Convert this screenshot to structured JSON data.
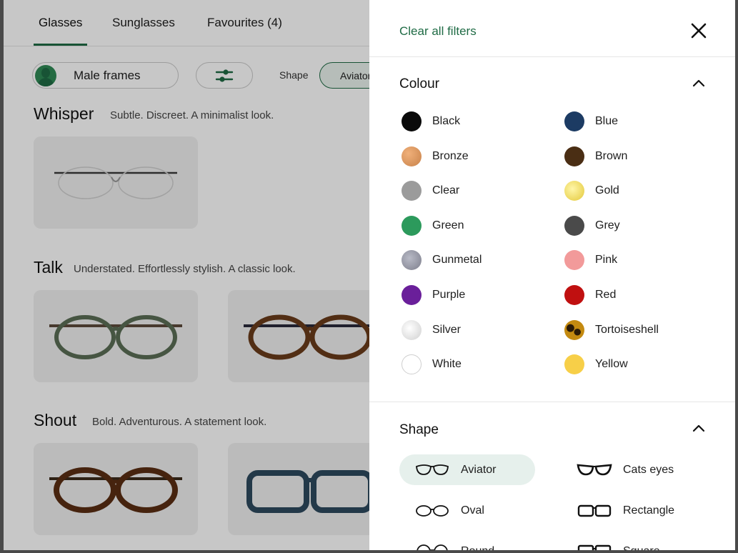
{
  "tabs": [
    {
      "label": "Glasses"
    },
    {
      "label": "Sunglasses"
    },
    {
      "label": "Favourites (4)"
    }
  ],
  "filterbar": {
    "gender_label": "Male frames",
    "shape_label": "Shape",
    "shape_chip": "Aviator"
  },
  "sections": [
    {
      "title": "Whisper",
      "subtitle": "Subtle. Discreet. A minimalist look."
    },
    {
      "title": "Talk",
      "subtitle": "Understated. Effortlessly stylish. A classic look."
    },
    {
      "title": "Shout",
      "subtitle": "Bold. Adventurous. A statement look."
    }
  ],
  "drawer": {
    "clear_all": "Clear all filters",
    "colour_title": "Colour",
    "shape_title": "Shape",
    "colours": [
      {
        "label": "Black",
        "color": "#0a0a0a"
      },
      {
        "label": "Blue",
        "color": "#1c3b63"
      },
      {
        "label": "Bronze",
        "color": "#c8824a"
      },
      {
        "label": "Brown",
        "color": "#4a2e14"
      },
      {
        "label": "Clear",
        "color": "#9b9b9b"
      },
      {
        "label": "Gold",
        "color": "#e3c83a"
      },
      {
        "label": "Green",
        "color": "#2c9a5c"
      },
      {
        "label": "Grey",
        "color": "#4a4a4a"
      },
      {
        "label": "Gunmetal",
        "color": "#7d7e8c"
      },
      {
        "label": "Pink",
        "color": "#f29a9a"
      },
      {
        "label": "Purple",
        "color": "#6a1f9a"
      },
      {
        "label": "Red",
        "color": "#c01010"
      },
      {
        "label": "Silver",
        "color": "#cfcfcf"
      },
      {
        "label": "Tortoiseshell",
        "color": "#c48a10"
      },
      {
        "label": "White",
        "color": "#ffffff"
      },
      {
        "label": "Yellow",
        "color": "#f7cf48"
      }
    ],
    "shapes": [
      {
        "label": "Aviator",
        "icon": "aviator-frame-icon",
        "selected": true
      },
      {
        "label": "Cats eyes",
        "icon": "cats-eyes-frame-icon",
        "selected": false
      },
      {
        "label": "Oval",
        "icon": "oval-frame-icon",
        "selected": false
      },
      {
        "label": "Rectangle",
        "icon": "rectangle-frame-icon",
        "selected": false
      },
      {
        "label": "Round",
        "icon": "round-frame-icon",
        "selected": false
      },
      {
        "label": "Square",
        "icon": "square-frame-icon",
        "selected": false
      }
    ]
  },
  "colors": {
    "brand_green": "#1f6b45",
    "selected_bg": "#e6f0ec"
  }
}
